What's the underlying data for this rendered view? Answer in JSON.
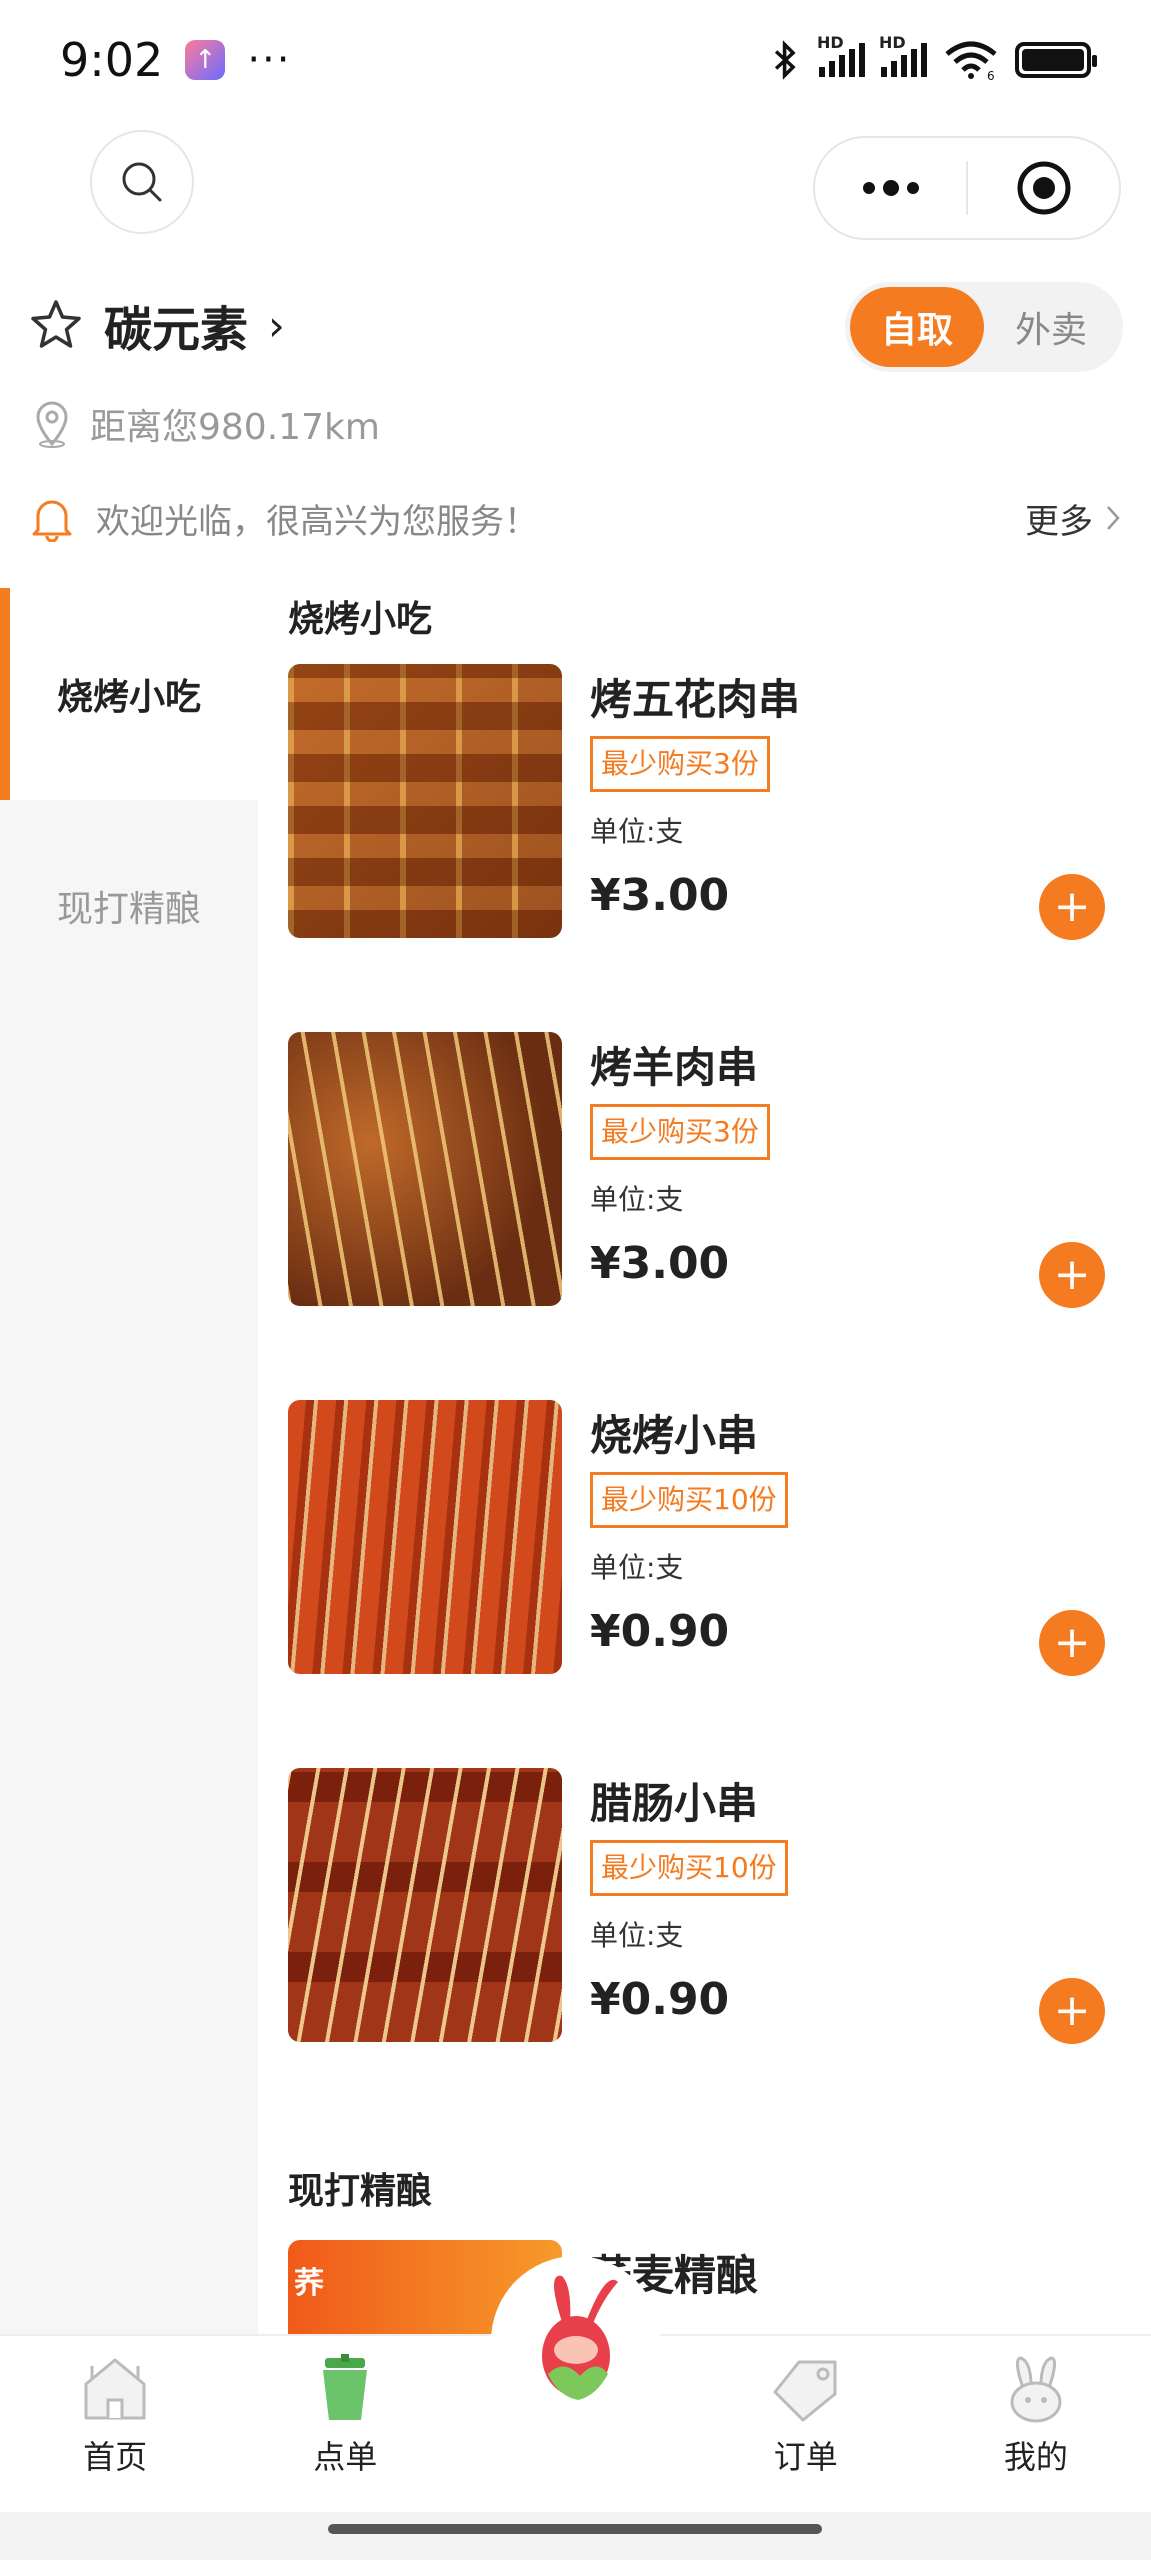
{
  "status_bar": {
    "time": "9:02",
    "more": "···",
    "network_label_1": "HD",
    "network_label_2": "HD",
    "wifi_label": "6"
  },
  "store": {
    "name": "碳元素",
    "chevron": "›",
    "mode_options": [
      "自取",
      "外卖"
    ],
    "selected_mode": "自取",
    "distance": "距离您980.17km",
    "notice": "欢迎光临，很高兴为您服务！",
    "more_label": "更多"
  },
  "categories": [
    {
      "label": "烧烤小吃",
      "active": true
    },
    {
      "label": "现打精酿",
      "active": false
    }
  ],
  "sections": [
    {
      "title": "烧烤小吃",
      "products": [
        {
          "name": "烤五花肉串",
          "min_buy": "最少购买3份",
          "unit": "单位:支",
          "price": "¥3.00"
        },
        {
          "name": "烤羊肉串",
          "min_buy": "最少购买3份",
          "unit": "单位:支",
          "price": "¥3.00"
        },
        {
          "name": "烧烤小串",
          "min_buy": "最少购买10份",
          "unit": "单位:支",
          "price": "¥0.90"
        },
        {
          "name": "腊肠小串",
          "min_buy": "最少购买10份",
          "unit": "单位:支",
          "price": "¥0.90"
        }
      ]
    },
    {
      "title": "现打精酿",
      "products": [
        {
          "name": "荞麦精酿",
          "thumb_text": "荞"
        }
      ]
    }
  ],
  "tabbar": {
    "items": [
      {
        "label": "首页",
        "icon": "house-icon"
      },
      {
        "label": "点单",
        "icon": "cup-icon"
      },
      {
        "label": "",
        "icon": "mascot-icon"
      },
      {
        "label": "订单",
        "icon": "tag-icon"
      },
      {
        "label": "我的",
        "icon": "rabbit-icon"
      }
    ]
  },
  "colors": {
    "accent": "#f47b20",
    "sidebar_bg": "#f6f6f6",
    "muted_text": "#999999"
  }
}
